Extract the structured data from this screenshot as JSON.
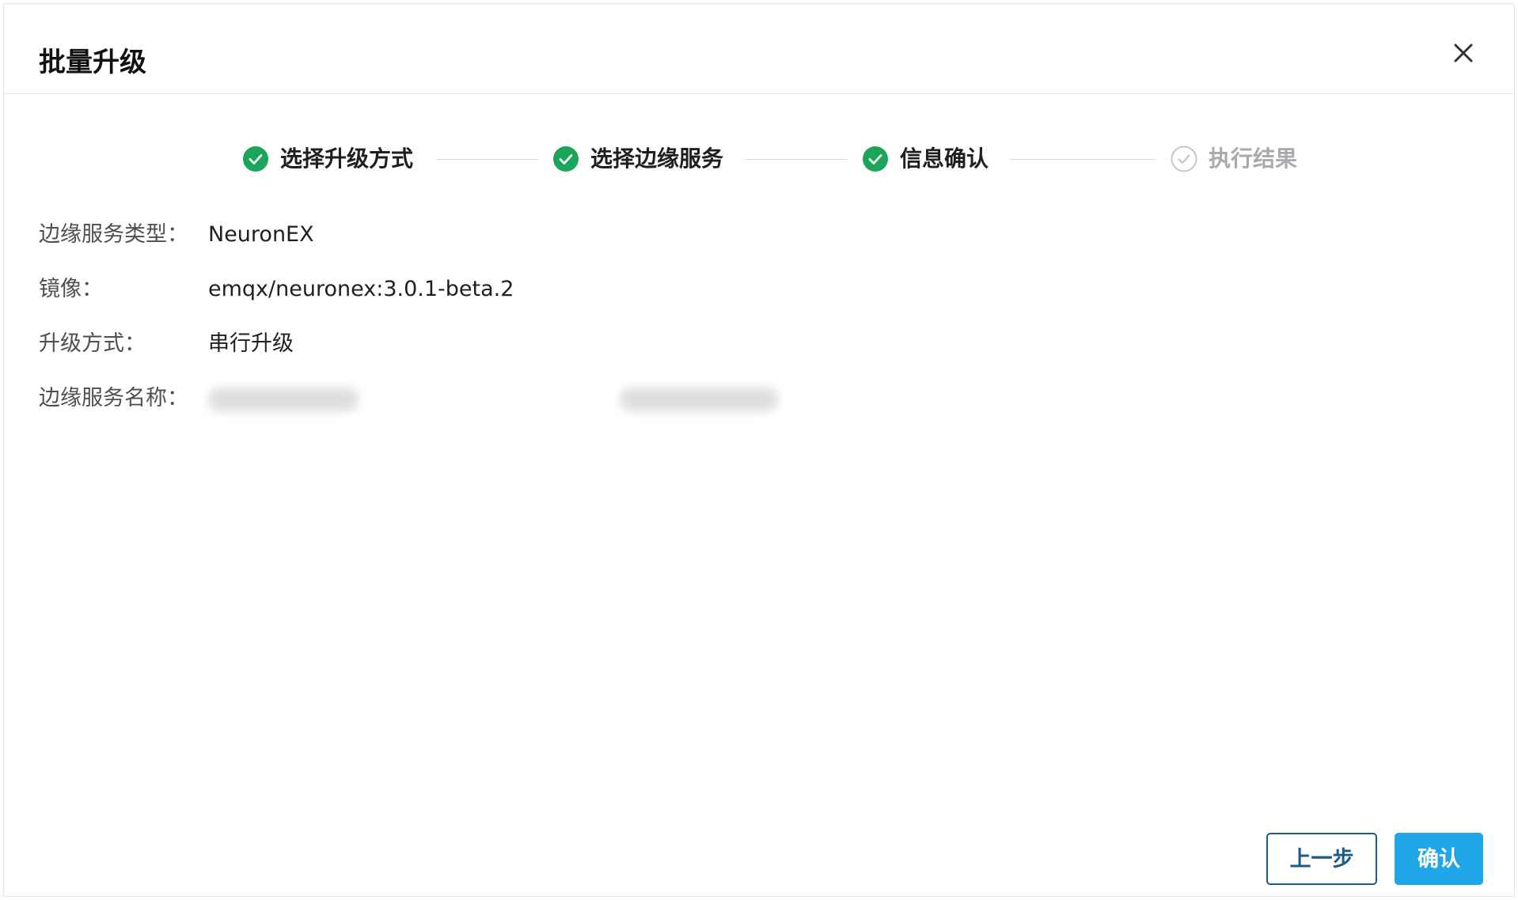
{
  "dialog": {
    "title": "批量升级",
    "close_icon": "close-icon"
  },
  "steps": [
    {
      "label": "选择升级方式",
      "status": "done",
      "icon": "check-circle-icon"
    },
    {
      "label": "选择边缘服务",
      "status": "done",
      "icon": "check-circle-icon"
    },
    {
      "label": "信息确认",
      "status": "done",
      "icon": "check-circle-icon"
    },
    {
      "label": "执行结果",
      "status": "pending",
      "icon": "check-circle-outline-icon"
    }
  ],
  "info": {
    "service_type": {
      "label": "边缘服务类型：",
      "value": "NeuronEX"
    },
    "image": {
      "label": "镜像：",
      "value": "emqx/neuronex:3.0.1-beta.2"
    },
    "upgrade_mode": {
      "label": "升级方式：",
      "value": "串行升级"
    },
    "service_names": {
      "label": "边缘服务名称："
    }
  },
  "footer": {
    "prev_label": "上一步",
    "confirm_label": "确认"
  },
  "colors": {
    "step_done": "#1aa55a",
    "step_pending": "#c4c6c9",
    "primary": "#1ea6e8",
    "prev_border": "#1e5a84"
  }
}
